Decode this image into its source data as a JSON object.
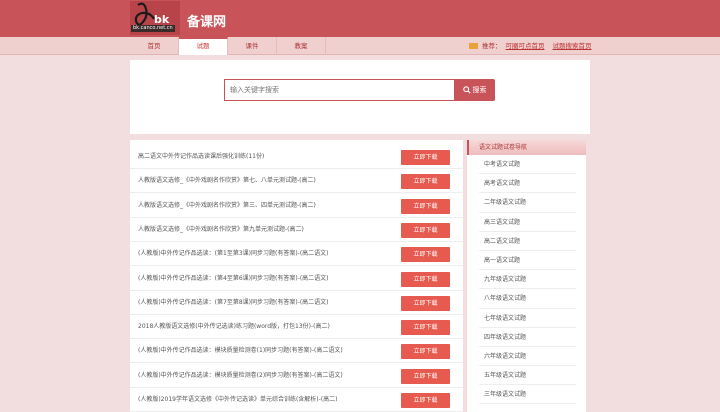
{
  "header": {
    "logo_text": "bk",
    "logo_domain": "bk.canco.net.cn",
    "site_name": "备课网"
  },
  "nav": {
    "tabs": [
      {
        "label": "首页",
        "active": false
      },
      {
        "label": "试题",
        "active": true
      },
      {
        "label": "课件",
        "active": false
      },
      {
        "label": "教案",
        "active": false
      }
    ],
    "recommend_label": "推荐：",
    "recommend_link": "可圈可点首页",
    "second_link": "试题搜索首页"
  },
  "search": {
    "placeholder": "输入关键字搜索",
    "button_label": "搜索"
  },
  "list": {
    "download_label": "立即下载",
    "items": [
      "高二语文中外传记作品选读课后强化训练(11份)",
      "人教版语文选修_《中外戏剧名作欣赏》第七、八单元测试题-(高二)",
      "人教版语文选修_《中外戏剧名作欣赏》第三、四单元测试题-(高二)",
      "人教版语文选修_《中外戏剧名作欣赏》第九单元测试题-(高二)",
      "(人教版)中外传记作品选读：(第1至第3课)同步习题(有答案)-(高二语文)",
      "(人教版)中外传记作品选读：(第4至第6课)同步习题(有答案)-(高二语文)",
      "(人教版)中外传记作品选读：(第7至第8课)同步习题(有答案)-(高二语文)",
      "2018人教版语文选修(中外传记选读)练习题(word版，打包13份)-(高二)",
      "(人教版)中外传记作品选读：模块质量检测卷(1)同步习题(有答案)-(高二语文)",
      "(人教版)中外传记作品选读：模块质量检测卷(2)同步习题(有答案)-(高二语文)",
      "(人教版)2019学年语文选修《中外传记选读》单元综合训练(含解析)-(高二)"
    ]
  },
  "sidebar": {
    "title": "语文试题试卷导航",
    "items": [
      "中考语文试题",
      "高考语文试题",
      "二年级语文试题",
      "高三语文试题",
      "高二语文试题",
      "高一语文试题",
      "九年级语文试题",
      "八年级语文试题",
      "七年级语文试题",
      "四年级语文试题",
      "六年级语文试题",
      "五年级语文试题",
      "三年级语文试题"
    ]
  },
  "colors": {
    "brand": "#c8545a",
    "download_button": "#e65a4f",
    "page_background": "#f2dede"
  }
}
